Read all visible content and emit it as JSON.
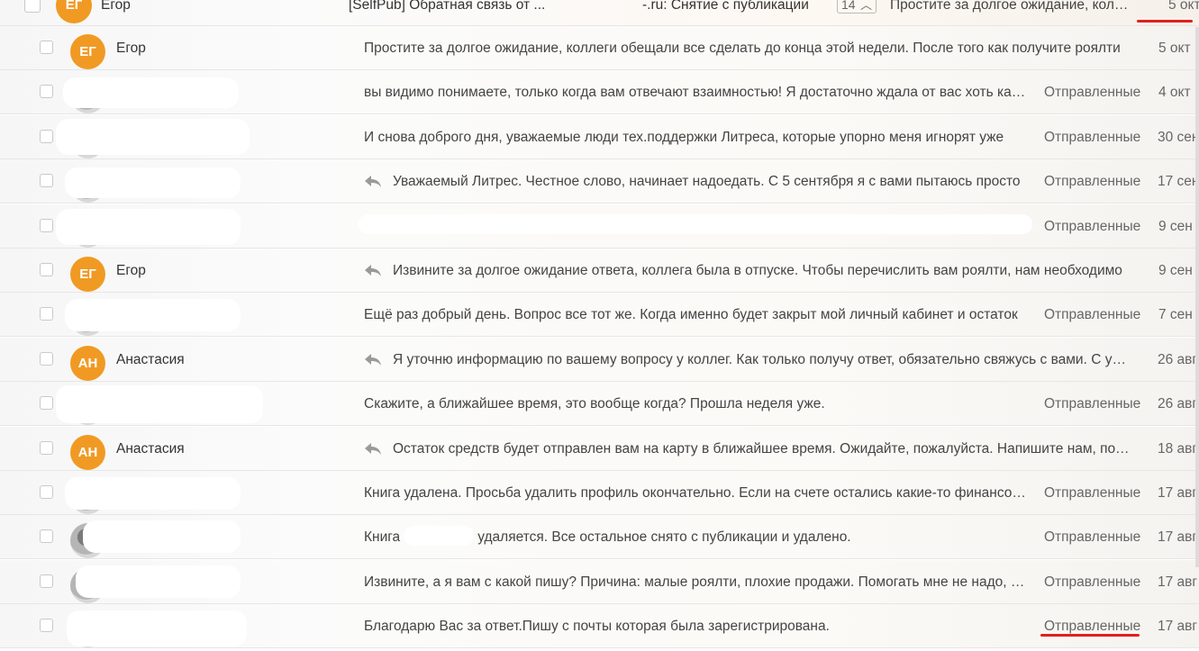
{
  "folder_label": "Отправленные",
  "top_row": {
    "avatar": "ЕГ",
    "sender": "Егор",
    "subject": "[SelfPub] Обратная связь от ...                         -.ru: Снятие с публикации",
    "thread_count": "14",
    "snippet": "Простите за долгое ожидание, коллеги обещали все сделать до конца этой недели",
    "date": "5 окт"
  },
  "messages": [
    {
      "avatar": "ЕГ",
      "sender": "Егор",
      "replied": false,
      "snippet": "Простите за долгое ожидание, коллеги обещали все сделать до конца этой недели. После того как получите роялти",
      "folder": "",
      "date": "5 окт"
    },
    {
      "avatar": "",
      "sender": "",
      "replied": false,
      "snippet": "вы видимо понимаете, только когда вам отвечают взаимностью! Я достаточно ждала от вас хоть какого-то ответа",
      "folder": "Отправленные",
      "date": "4 окт"
    },
    {
      "avatar": "",
      "sender": "",
      "replied": false,
      "snippet": "И снова доброго дня, уважаемые люди тех.поддержки Литреса, которые упорно меня игнорят уже",
      "folder": "Отправленные",
      "date": "30 сен"
    },
    {
      "avatar": "",
      "sender": "",
      "replied": true,
      "snippet": "Уважаемый Литрес. Честное слово, начинает надоедать. С 5 сентября я с вами пытаюсь просто",
      "folder": "Отправленные",
      "date": "17 сен"
    },
    {
      "avatar": "",
      "sender": "",
      "replied": false,
      "snippet": "",
      "folder": "Отправленные",
      "date": "9 сен"
    },
    {
      "avatar": "ЕГ",
      "sender": "Егор",
      "replied": true,
      "snippet": "Извините за долгое ожидание ответа, коллега была в отпуске. Чтобы перечислить вам роялти, нам необходимо",
      "folder": "",
      "date": "9 сен"
    },
    {
      "avatar": "",
      "sender": "",
      "replied": false,
      "snippet": "Ещё раз добрый день. Вопрос все тот же. Когда именно будет закрыт мой личный кабинет и остаток",
      "folder": "Отправленные",
      "date": "7 сен"
    },
    {
      "avatar": "АН",
      "sender": "Анастасия",
      "replied": true,
      "snippet": "Я уточню информацию по вашему вопросу у коллег. Как только получу ответ, обязательно свяжусь с вами. С уважением",
      "folder": "",
      "date": "26 авг"
    },
    {
      "avatar": "",
      "sender": "",
      "replied": false,
      "snippet": "Скажите, а ближайшее время, это вообще когда? Прошла неделя уже.",
      "folder": "Отправленные",
      "date": "26 авг"
    },
    {
      "avatar": "АН",
      "sender": "Анастасия",
      "replied": true,
      "snippet": "Остаток средств будет отправлен вам на карту в ближайшее время. Ожидайте, пожалуйста. Напишите нам, пожалуйста",
      "folder": "",
      "date": "18 авг"
    },
    {
      "avatar": "",
      "sender": "",
      "replied": false,
      "snippet": "Книга удалена. Просьба удалить профиль окончательно. Если на счете остались какие-то финансовые средства",
      "folder": "Отправленные",
      "date": "17 авг"
    },
    {
      "avatar": "",
      "sender": "",
      "replied": false,
      "snippet": "Книга               не удаляется. Все остальное снято с публикации и удалено.",
      "folder": "Отправленные",
      "date": "17 авг"
    },
    {
      "avatar": "",
      "sender": "",
      "replied": false,
      "snippet": "Извините, а я вам с какой пишу? Причина: малые роялти, плохие продажи. Помогать мне не надо, спасибо",
      "folder": "Отправленные",
      "date": "17 авг"
    },
    {
      "avatar": "",
      "sender": "",
      "replied": false,
      "snippet": "Благодарю Вас за ответ.Пишу с почты которая была зарегистрирована.",
      "folder": "Отправленные",
      "date": "17 авг"
    }
  ],
  "colors": {
    "avatar_initials_bg": "#f09a24",
    "annotation_red": "#e02020"
  }
}
